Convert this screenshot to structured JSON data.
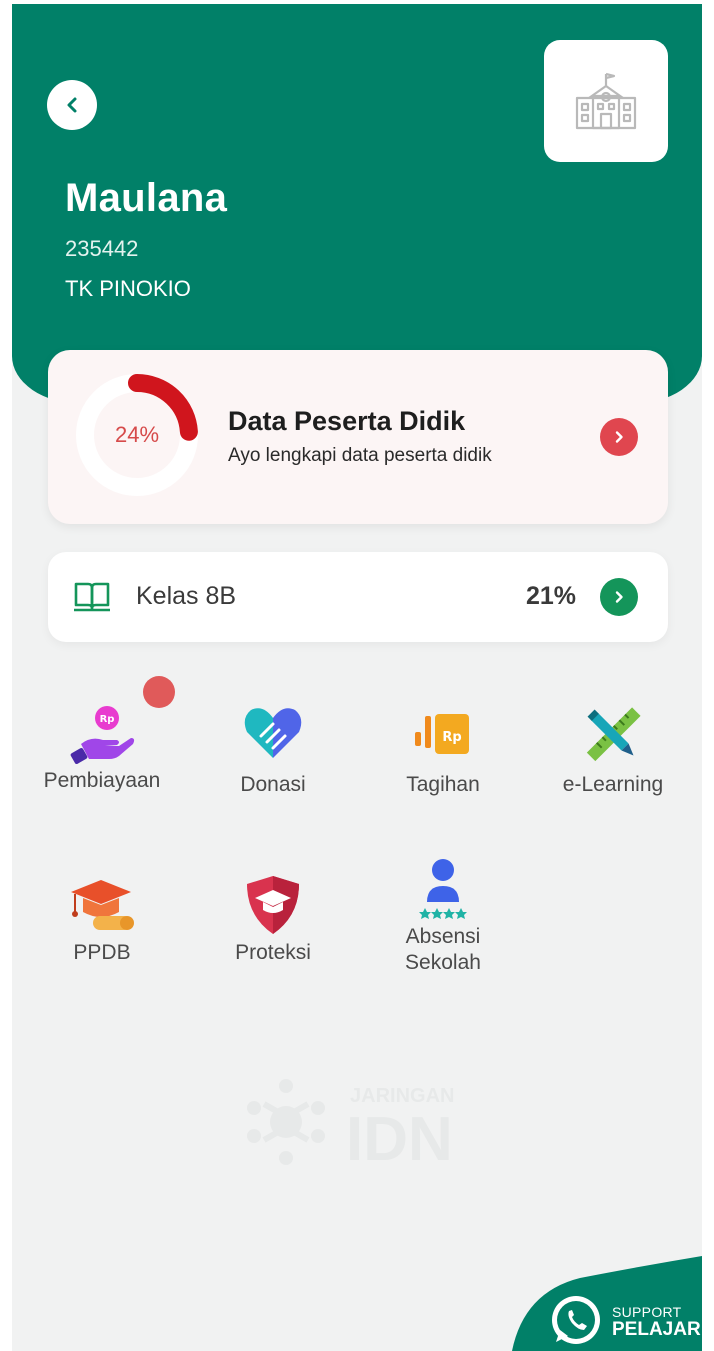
{
  "header": {
    "student_name": "Maulana",
    "student_id": "235442",
    "school_name": "TK PINOKIO",
    "background_color": "#018068"
  },
  "profile_card": {
    "progress_percent": 24,
    "progress_label": "24%",
    "title": "Data Peserta Didik",
    "subtitle": "Ayo lengkapi data peserta didik",
    "accent_color": "#d0151d"
  },
  "class_card": {
    "label": "Kelas 8B",
    "percent_label": "21%",
    "icon": "book-icon"
  },
  "menu": [
    {
      "label": "Pembiayaan",
      "icon": "financing-hand-icon",
      "has_notification": true
    },
    {
      "label": "Donasi",
      "icon": "heart-handshake-icon"
    },
    {
      "label": "Tagihan",
      "icon": "bill-chart-icon"
    },
    {
      "label": "e-Learning",
      "icon": "pencil-ruler-icon"
    },
    {
      "label": "PPDB",
      "icon": "graduation-cap-icon"
    },
    {
      "label": "Proteksi",
      "icon": "shield-cap-icon"
    },
    {
      "label": "Absensi\nSekolah",
      "label_line1": "Absensi",
      "label_line2": "Sekolah",
      "icon": "attendance-person-icon"
    }
  ],
  "watermark": {
    "line1": "JARINGAN",
    "line2": "IDN"
  },
  "support": {
    "line1": "SUPPORT",
    "line2": "PELAJAR",
    "icon": "whatsapp-icon"
  }
}
